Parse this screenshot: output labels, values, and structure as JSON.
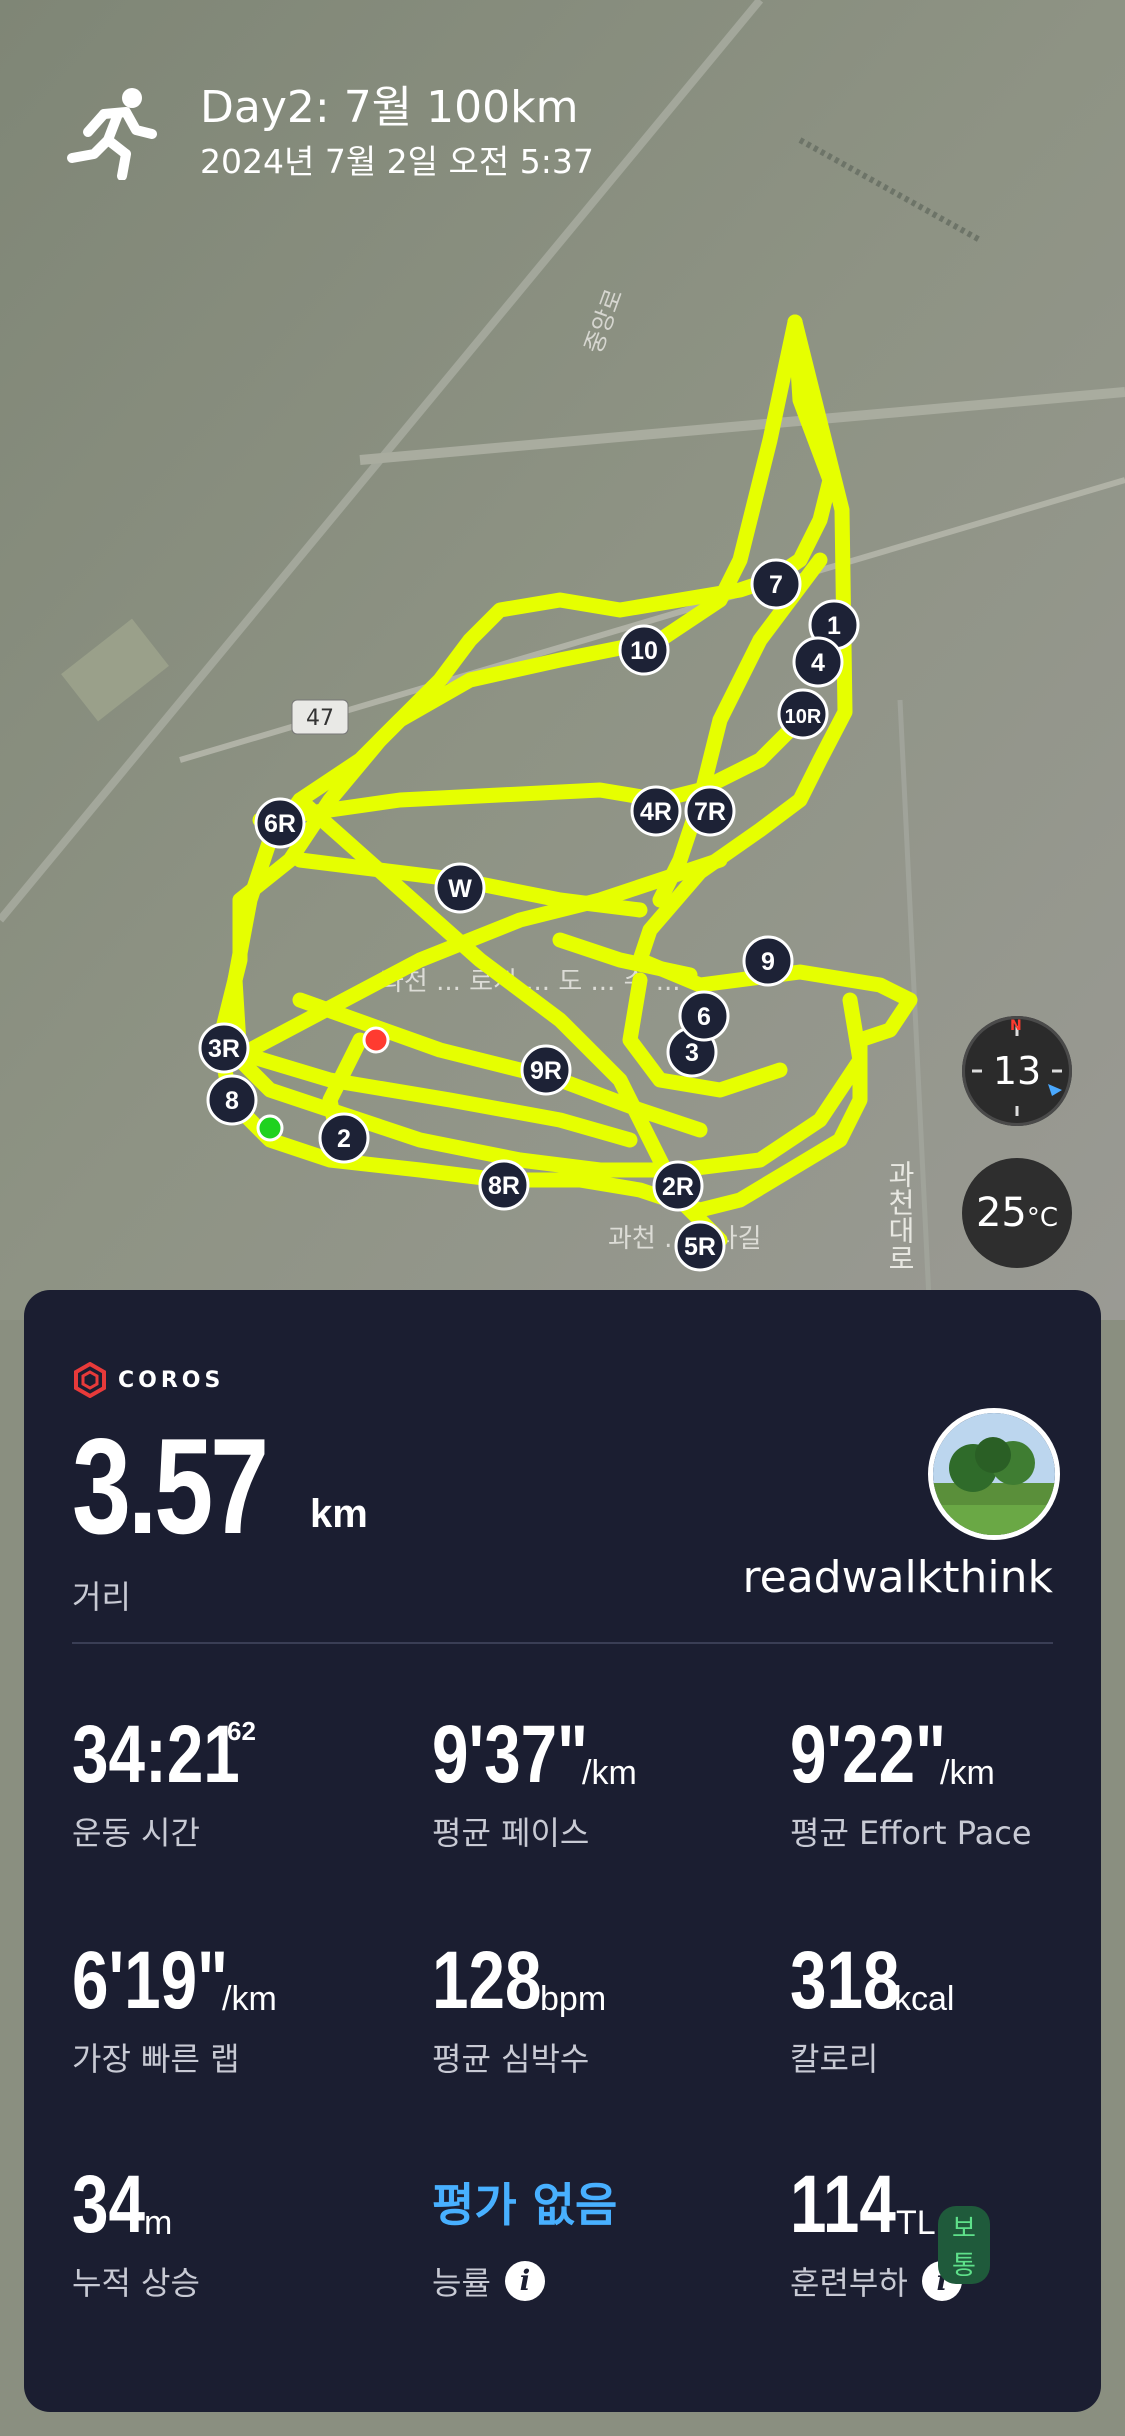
{
  "header": {
    "title": "Day2: 7월 100km",
    "datetime": "2024년 7월 2일 오전 5:37"
  },
  "map": {
    "route_color": "#e8ff00",
    "road_label_1": "중앙로",
    "road_sign": "47",
    "area_label": "과천 ... 로지 ... 도 ... 수 ...",
    "road_label_2": "과천대로",
    "road_label_3": "과천 ... 2나길",
    "markers": [
      "1",
      "2",
      "3",
      "4",
      "6",
      "7",
      "8",
      "9",
      "10",
      "2R",
      "3R",
      "4R",
      "5R",
      "6R",
      "7R",
      "8R",
      "9R",
      "10R",
      "W"
    ],
    "compass_value": "13",
    "compass_north": "N",
    "temperature": "25",
    "temperature_unit": "°C"
  },
  "card": {
    "brand": "COROS",
    "distance_value": "3.57",
    "distance_unit": "km",
    "distance_label": "거리",
    "username": "readwalkthink",
    "stats": {
      "time_value": "34:21",
      "time_fraction": "62",
      "time_label": "운동 시간",
      "avg_pace_value": "9'37\"",
      "avg_pace_unit": "/km",
      "avg_pace_label": "평균 페이스",
      "effort_pace_value": "9'22\"",
      "effort_pace_unit": "/km",
      "effort_pace_label": "평균 Effort Pace",
      "fastest_lap_value": "6'19\"",
      "fastest_lap_unit": "/km",
      "fastest_lap_label": "가장 빠른 랩",
      "hr_value": "128",
      "hr_unit": "bpm",
      "hr_label": "평균 심박수",
      "cal_value": "318",
      "cal_unit": "kcal",
      "cal_label": "칼로리",
      "ascent_value": "34",
      "ascent_unit": "m",
      "ascent_label": "누적 상승",
      "efficiency_value": "평가 없음",
      "efficiency_label": "능률",
      "load_value": "114",
      "load_unit": "TL",
      "load_badge": "보통",
      "load_label": "훈련부하"
    }
  }
}
